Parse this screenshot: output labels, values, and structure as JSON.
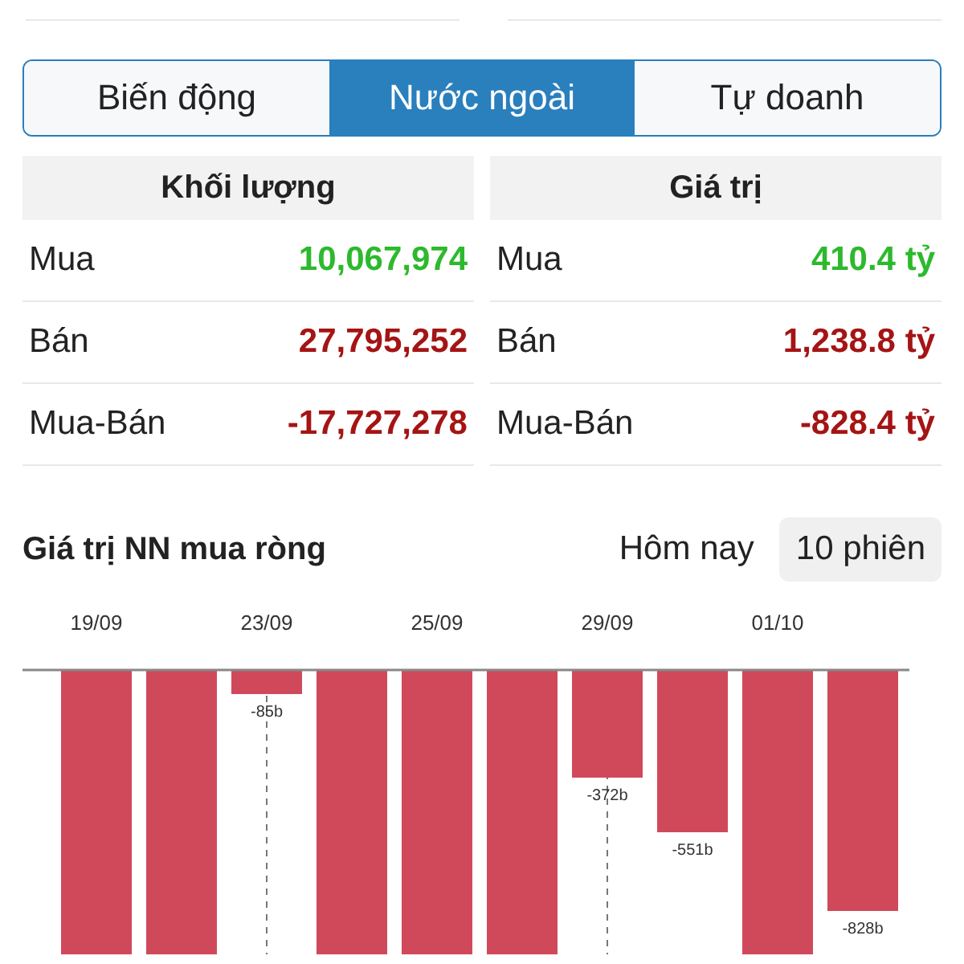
{
  "tabs": [
    {
      "label": "Biến động",
      "selected": false
    },
    {
      "label": "Nước ngoài",
      "selected": true
    },
    {
      "label": "Tự doanh",
      "selected": false
    }
  ],
  "summary": {
    "columns": [
      {
        "title": "Khối lượng",
        "rows": [
          {
            "label": "Mua",
            "value": "10,067,974",
            "color": "#2db92d"
          },
          {
            "label": "Bán",
            "value": "27,795,252",
            "color": "#a51414"
          },
          {
            "label": "Mua-Bán",
            "value": "-17,727,278",
            "color": "#a51414"
          }
        ]
      },
      {
        "title": "Giá trị",
        "rows": [
          {
            "label": "Mua",
            "value": "410.4 tỷ",
            "color": "#2db92d"
          },
          {
            "label": "Bán",
            "value": "1,238.8 tỷ",
            "color": "#a51414"
          },
          {
            "label": "Mua-Bán",
            "value": "-828.4 tỷ",
            "color": "#a51414"
          }
        ]
      }
    ]
  },
  "net_section": {
    "title": "Giá trị NN mua ròng",
    "periods": [
      {
        "label": "Hôm nay",
        "selected": false
      },
      {
        "label": "10 phiên",
        "selected": true
      }
    ],
    "bar_chart": {
      "dates": [
        "19/09",
        "23/09",
        "25/09",
        "29/09",
        "01/10"
      ],
      "bar_labels": [
        "-85b",
        "-372b",
        "-551b",
        "-828b"
      ]
    }
  }
}
